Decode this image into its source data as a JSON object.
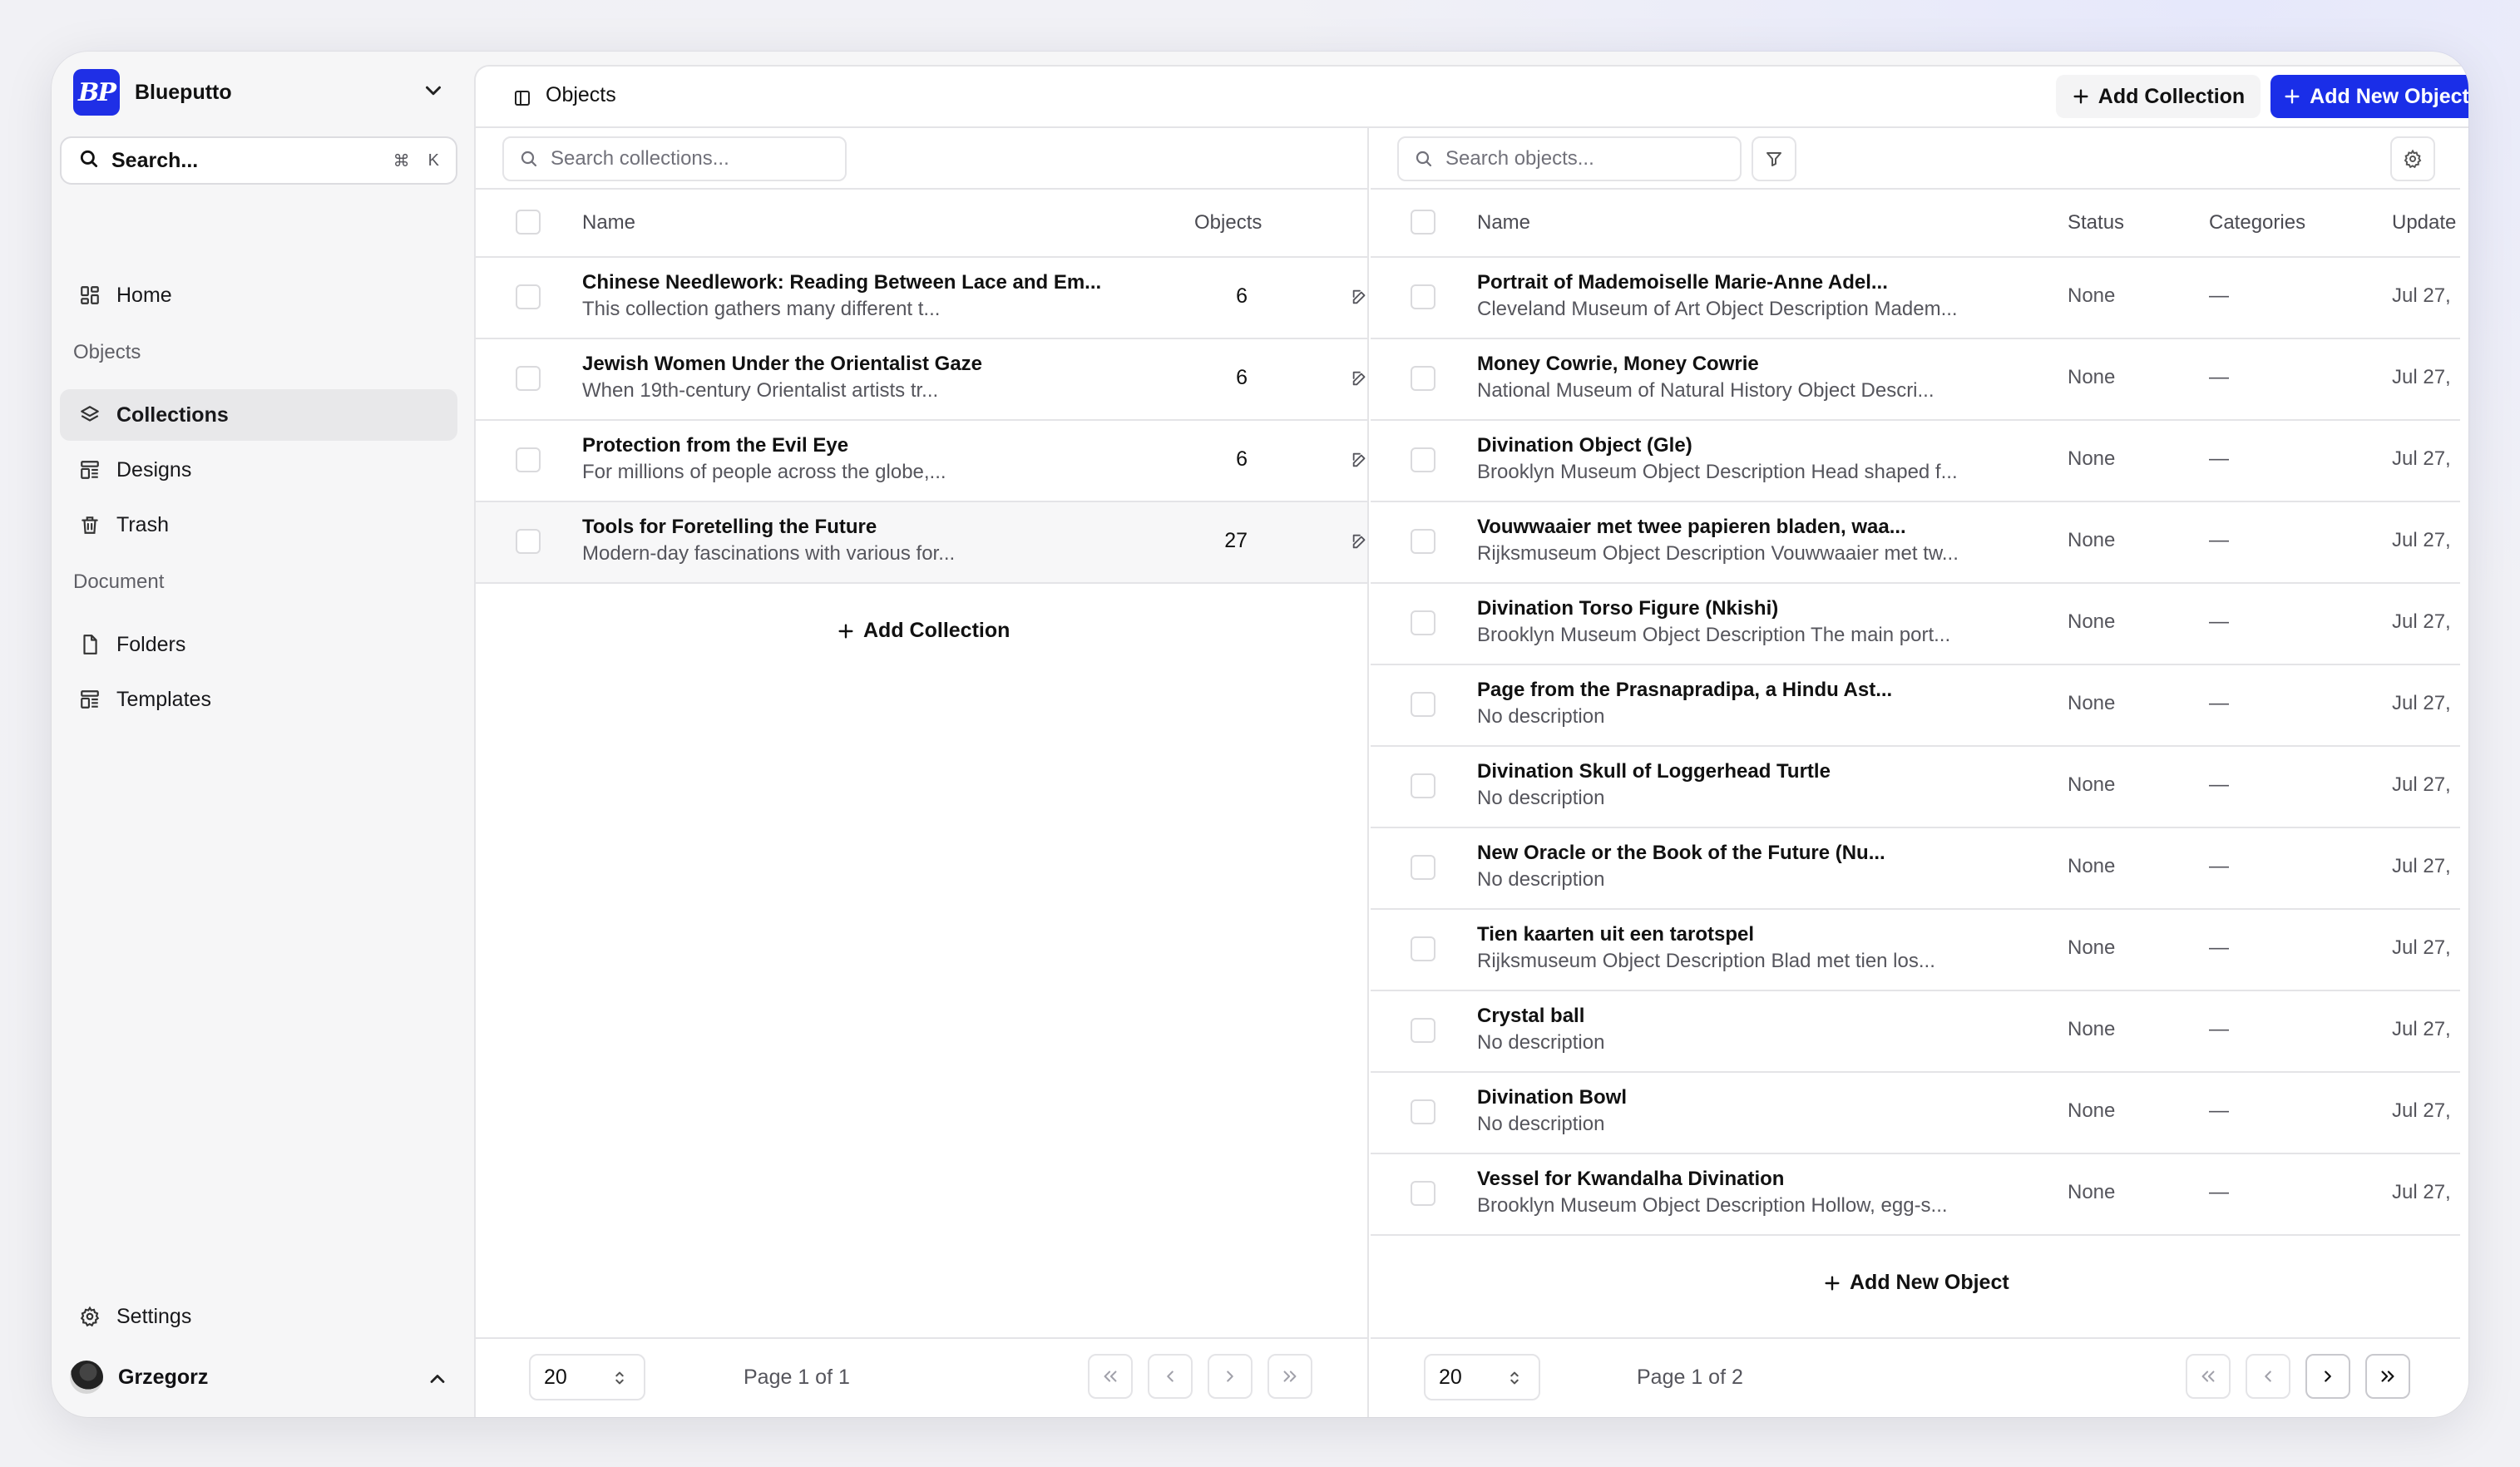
{
  "app": {
    "name": "Blueputto",
    "logo_text": "BP",
    "brand_color": "#1a2ee8"
  },
  "sidebar": {
    "search_label": "Search...",
    "shortcut_mod": "⌘",
    "shortcut_key": "K",
    "home": "Home",
    "section_objects": "Objects",
    "collections": "Collections",
    "designs": "Designs",
    "trash": "Trash",
    "section_document": "Document",
    "folders": "Folders",
    "templates": "Templates",
    "settings": "Settings",
    "user_name": "Grzegorz"
  },
  "topbar": {
    "title": "Objects",
    "add_collection": "Add Collection",
    "add_new_object": "Add New Object"
  },
  "collections": {
    "search_placeholder": "Search collections...",
    "columns": {
      "name": "Name",
      "objects": "Objects"
    },
    "rows": [
      {
        "title": "Chinese Needlework: Reading Between Lace and Em...",
        "description": "This collection gathers many different t...",
        "objects": "6"
      },
      {
        "title": "Jewish Women Under the Orientalist Gaze",
        "description": "When 19th-century Orientalist artists tr...",
        "objects": "6"
      },
      {
        "title": "Protection from the Evil Eye",
        "description": "For millions of people across the globe,...",
        "objects": "6"
      },
      {
        "title": "Tools for Foretelling the Future",
        "description": "Modern-day fascinations with various for...",
        "objects": "27"
      }
    ],
    "add_label": "Add Collection",
    "page_size": "20",
    "page_label": "Page 1 of 1"
  },
  "objects": {
    "search_placeholder": "Search objects...",
    "columns": {
      "name": "Name",
      "status": "Status",
      "categories": "Categories",
      "updated": "Update"
    },
    "rows": [
      {
        "title": "Portrait of Mademoiselle Marie-Anne Adel...",
        "description": "Cleveland Museum of Art Object Description Madem...",
        "status": "None",
        "categories": "—",
        "updated": "Jul 27,"
      },
      {
        "title": "Money Cowrie, Money Cowrie",
        "description": "National Museum of Natural History Object Descri...",
        "status": "None",
        "categories": "—",
        "updated": "Jul 27,"
      },
      {
        "title": "Divination Object (Gle)",
        "description": "Brooklyn Museum Object Description Head shaped f...",
        "status": "None",
        "categories": "—",
        "updated": "Jul 27,"
      },
      {
        "title": "Vouwwaaier met twee papieren bladen, waa...",
        "description": "Rijksmuseum Object Description Vouwwaaier met tw...",
        "status": "None",
        "categories": "—",
        "updated": "Jul 27,"
      },
      {
        "title": "Divination Torso Figure (Nkishi)",
        "description": "Brooklyn Museum Object Description The main port...",
        "status": "None",
        "categories": "—",
        "updated": "Jul 27,"
      },
      {
        "title": "Page from the Prasnapradipa, a Hindu Ast...",
        "description": "No description",
        "status": "None",
        "categories": "—",
        "updated": "Jul 27,"
      },
      {
        "title": "Divination Skull of Loggerhead Turtle",
        "description": "No description",
        "status": "None",
        "categories": "—",
        "updated": "Jul 27,"
      },
      {
        "title": "New Oracle or the Book of the Future (Nu...",
        "description": "No description",
        "status": "None",
        "categories": "—",
        "updated": "Jul 27,"
      },
      {
        "title": "Tien kaarten uit een tarotspel",
        "description": "Rijksmuseum Object Description Blad met tien los...",
        "status": "None",
        "categories": "—",
        "updated": "Jul 27,"
      },
      {
        "title": "Crystal ball",
        "description": "No description",
        "status": "None",
        "categories": "—",
        "updated": "Jul 27,"
      },
      {
        "title": "Divination Bowl",
        "description": "No description",
        "status": "None",
        "categories": "—",
        "updated": "Jul 27,"
      },
      {
        "title": "Vessel for Kwandalha Divination",
        "description": "Brooklyn Museum Object Description Hollow, egg-s...",
        "status": "None",
        "categories": "—",
        "updated": "Jul 27,"
      }
    ],
    "add_label": "Add New Object",
    "page_size": "20",
    "page_label": "Page 1 of 2"
  }
}
